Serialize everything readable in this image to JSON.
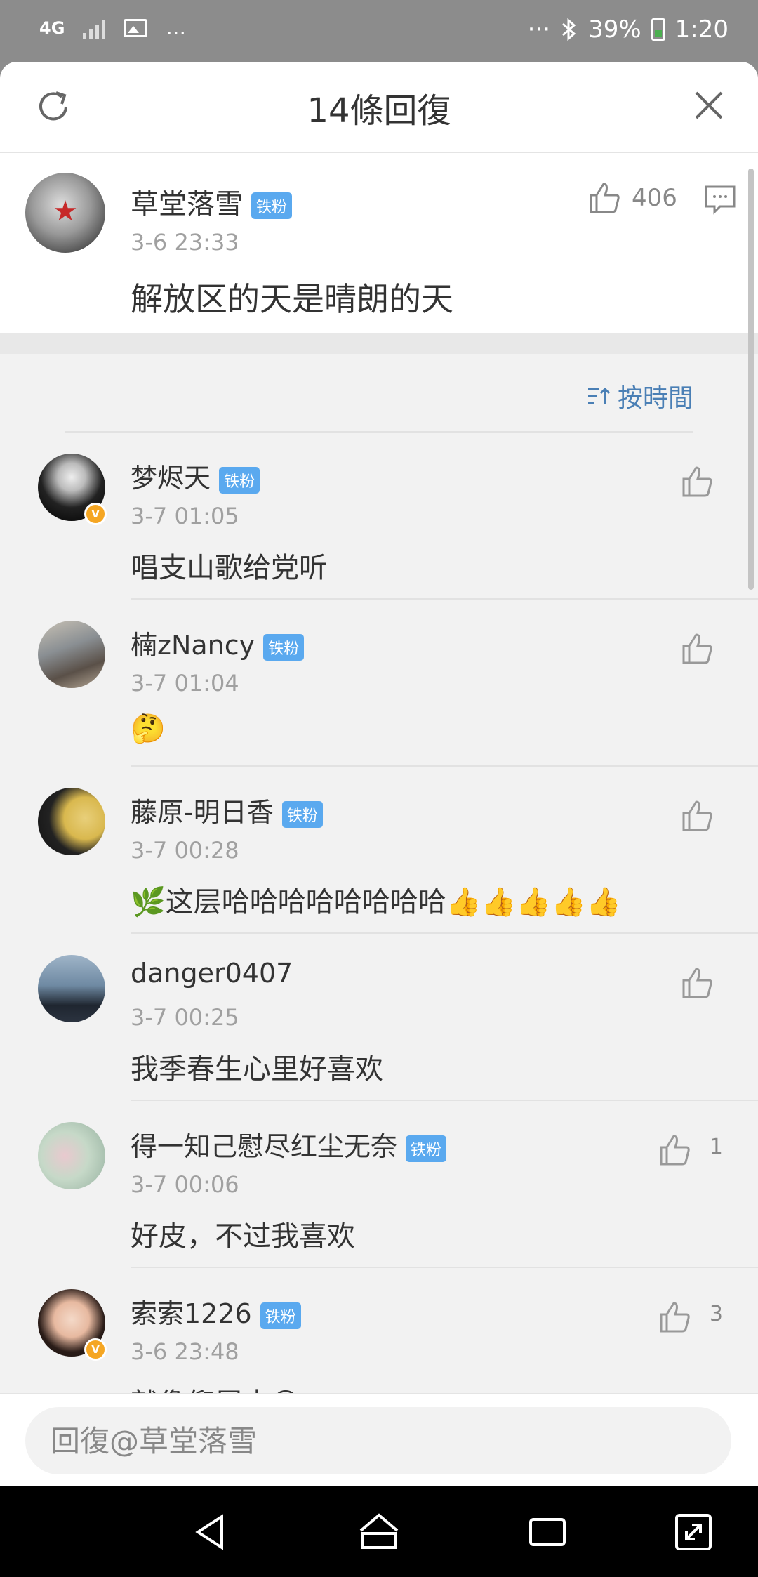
{
  "status_bar": {
    "network": "4G",
    "overflow": "...",
    "overflow_right": "···",
    "battery": "39%",
    "time": "1:20"
  },
  "header": {
    "title": "14條回復"
  },
  "main_comment": {
    "username": "草堂落雪",
    "badge": "铁粉",
    "time": "3-6 23:33",
    "text": "解放区的天是晴朗的天",
    "likes": "406"
  },
  "sort": {
    "label": "按時間"
  },
  "replies": [
    {
      "username": "梦烬天",
      "badge": "铁粉",
      "time": "3-7 01:05",
      "text": "唱支山歌给党听",
      "likes": "",
      "verified": true
    },
    {
      "username": "楠zNancy",
      "badge": "铁粉",
      "time": "3-7 01:04",
      "text": "🤔",
      "likes": ""
    },
    {
      "username": "藤原-明日香",
      "badge": "铁粉",
      "time": "3-7 00:28",
      "text": "🌿这层哈哈哈哈哈哈哈哈👍👍👍👍👍",
      "likes": ""
    },
    {
      "username": "danger0407",
      "badge": "",
      "time": "3-7 00:25",
      "text": "我季春生心里好喜欢",
      "likes": ""
    },
    {
      "username": "得一知己慰尽红尘无奈",
      "badge": "铁粉",
      "time": "3-7 00:06",
      "text": "好皮，不过我喜欢",
      "likes": "1"
    },
    {
      "username": "索索1226",
      "badge": "铁粉",
      "time": "3-6 23:48",
      "text": "就像仰屋中😊",
      "likes": "3",
      "verified": true
    }
  ],
  "reply_bar": {
    "placeholder": "回復@草堂落雪"
  },
  "colors": {
    "accent": "#4a7fb5",
    "badge": "#5aa9ef",
    "verified": "#f5a623"
  }
}
